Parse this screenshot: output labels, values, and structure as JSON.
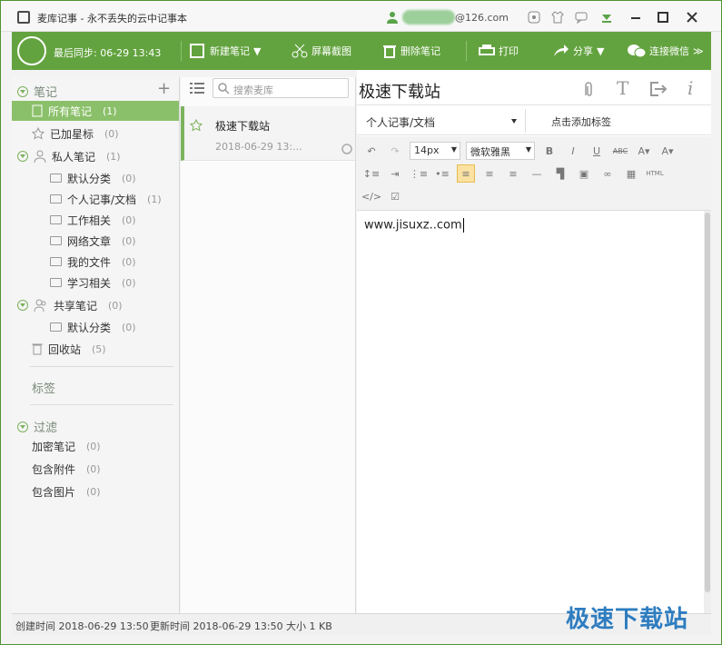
{
  "titlebar": {
    "app_title": "麦库记事 - 永不丢失的云中记事本",
    "user_email": "@126.com",
    "icons": [
      "skin-icon",
      "shirt-icon",
      "message-icon",
      "download-icon",
      "minimize-icon",
      "maximize-icon",
      "close-icon"
    ]
  },
  "toolbar": {
    "sync_text": "最后同步: 06-29 13:43",
    "new_note": "新建笔记",
    "screenshot": "屏幕截图",
    "delete_note": "删除笔记",
    "print": "打印",
    "share": "分享",
    "connect_wechat": "连接微信"
  },
  "sidebar": {
    "notes_header": "笔记",
    "all_notes": {
      "label": "所有笔记",
      "count": "(1)"
    },
    "starred": {
      "label": "已加星标",
      "count": "(0)"
    },
    "private": {
      "label": "私人笔记",
      "count": "(1)"
    },
    "folders": [
      {
        "label": "默认分类",
        "count": "(0)"
      },
      {
        "label": "个人记事/文档",
        "count": "(1)"
      },
      {
        "label": "工作相关",
        "count": "(0)"
      },
      {
        "label": "网络文章",
        "count": "(0)"
      },
      {
        "label": "我的文件",
        "count": "(0)"
      },
      {
        "label": "学习相关",
        "count": "(0)"
      }
    ],
    "shared": {
      "label": "共享笔记",
      "count": "(0)"
    },
    "shared_default": {
      "label": "默认分类",
      "count": "(0)"
    },
    "trash": {
      "label": "回收站",
      "count": "(5)"
    },
    "tags_header": "标签",
    "filter_header": "过滤",
    "filters": [
      {
        "label": "加密笔记",
        "count": "(0)"
      },
      {
        "label": "包含附件",
        "count": "(0)"
      },
      {
        "label": "包含图片",
        "count": "(0)"
      }
    ]
  },
  "note_list": {
    "search_placeholder": "搜索麦库",
    "note_title": "极速下载站",
    "note_date": "2018-06-29 13:..."
  },
  "editor": {
    "title": "极速下载站",
    "notebook": "个人记事/文档",
    "tag_button": "点击添加标签",
    "font_size": "14px",
    "font_name": "微软雅黑",
    "content": "www.jisuxz..com"
  },
  "status": {
    "created": "创建时间 2018-06-29 13:50",
    "updated": "更新时间 2018-06-29 13:50",
    "size": "大小 1 KB"
  },
  "watermark": "极速下载站",
  "colors": {
    "accent": "#63a33f",
    "selected": "#8bc06a",
    "watermark": "#2e7dc0"
  }
}
